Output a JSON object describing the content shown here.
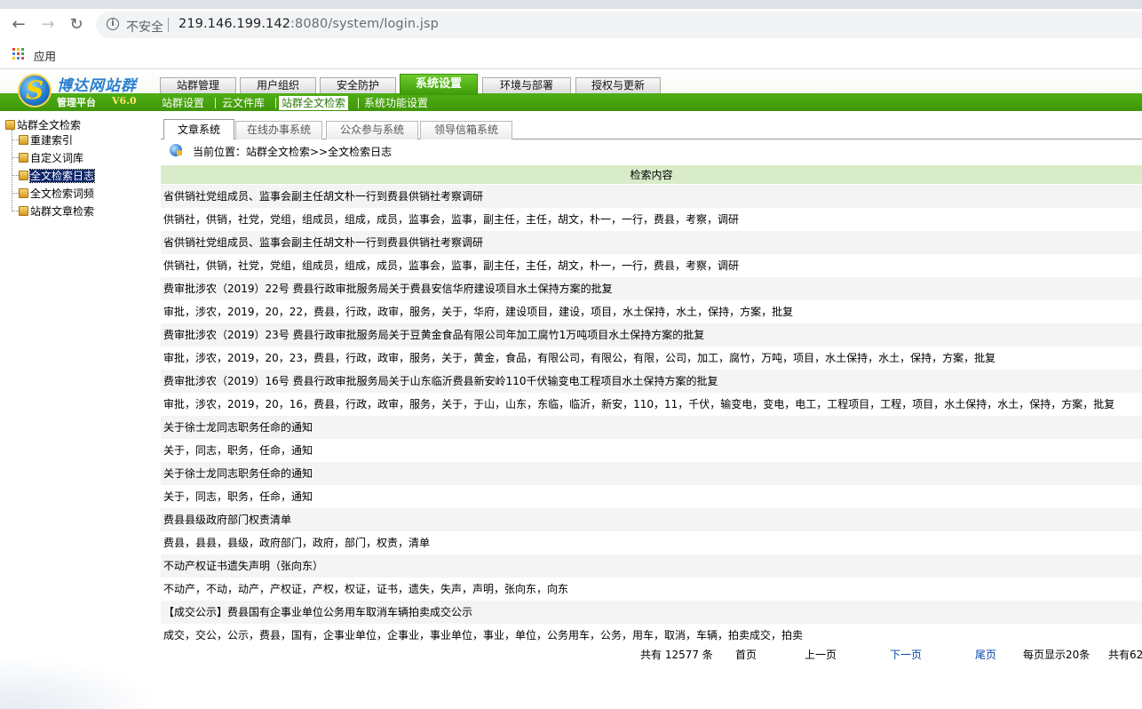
{
  "browser": {
    "insecure_label": "不安全",
    "url_host": "219.146.199.142",
    "url_rest": ":8080/system/login.jsp",
    "bookmarks_apps": "应用"
  },
  "app": {
    "brand": "博达网站群",
    "platform": "管理平台",
    "version": "V6.0",
    "main_tabs": [
      "站群管理",
      "用户组织",
      "安全防护",
      "系统设置",
      "环境与部署",
      "授权与更新"
    ],
    "active_main_tab": "系统设置",
    "sub_nav": [
      "站群设置",
      "云文件库",
      "站群全文检索",
      "系统功能设置"
    ],
    "active_sub_nav": "站群全文检索"
  },
  "tree": {
    "root": "站群全文检索",
    "items": [
      "重建索引",
      "自定义词库",
      "全文检索日志",
      "全文检索词频",
      "站群文章检索"
    ],
    "selected": "全文检索日志"
  },
  "content_tabs": [
    "文章系统",
    "在线办事系统",
    "公众参与系统",
    "领导信箱系统"
  ],
  "active_content_tab": "文章系统",
  "location": "当前位置：站群全文检索>>全文检索日志",
  "table": {
    "header": "检索内容",
    "rows": [
      "省供销社党组成员、监事会副主任胡文朴一行到费县供销社考察调研",
      "供销社，供销，社党，党组，组成员，组成，成员，监事会，监事，副主任，主任，胡文，朴一，一行，费县，考察，调研",
      "省供销社党组成员、监事会副主任胡文朴一行到费县供销社考察调研",
      "供销社，供销，社党，党组，组成员，组成，成员，监事会，监事，副主任，主任，胡文，朴一，一行，费县，考察，调研",
      "费审批涉农（2019）22号 费县行政审批服务局关于费县安信华府建设项目水土保持方案的批复",
      "审批，涉农，2019，20，22，费县，行政，政审，服务，关于，华府，建设项目，建设，项目，水土保持，水土，保持，方案，批复",
      "费审批涉农（2019）23号 费县行政审批服务局关于豆黄金食品有限公司年加工腐竹1万吨项目水土保持方案的批复",
      "审批，涉农，2019，20，23，费县，行政，政审，服务，关于，黄金，食品，有限公司，有限公，有限，公司，加工，腐竹，万吨，项目，水土保持，水土，保持，方案，批复",
      "费审批涉农（2019）16号 费县行政审批服务局关于山东临沂费县新安岭110千伏输变电工程项目水土保持方案的批复",
      "审批，涉农，2019，20，16，费县，行政，政审，服务，关于，于山，山东，东临，临沂，新安，110，11，千伏，输变电，变电，电工，工程项目，工程，项目，水土保持，水土，保持，方案，批复",
      "关于徐士龙同志职务任命的通知",
      "关于，同志，职务，任命，通知",
      "关于徐士龙同志职务任命的通知",
      "关于，同志，职务，任命，通知",
      "费县县级政府部门权责清单",
      "费县，县县，县级，政府部门，政府，部门，权责，清单",
      "不动产权证书遗失声明（张向东）",
      "不动产，不动，动产，产权证，产权，权证，证书，遗失，失声，声明，张向东，向东",
      "【成交公示】费县国有企事业单位公务用车取消车辆拍卖成交公示",
      "成交，交公，公示，费县，国有，企事业单位，企事业，事业单位，事业，单位，公务用车，公务，用车，取消，车辆，拍卖成交，拍卖"
    ]
  },
  "pager": {
    "total": "共有 12577 条",
    "first": "首页",
    "prev": "上一页",
    "next": "下一页",
    "last": "尾页",
    "per_page": "每页显示20条",
    "pages": "共有62"
  },
  "colors": {
    "brand_green": "#3f9608",
    "header_row": "#d8ecc9",
    "link": "#0645ad",
    "tree_selected": "#0a246a"
  }
}
